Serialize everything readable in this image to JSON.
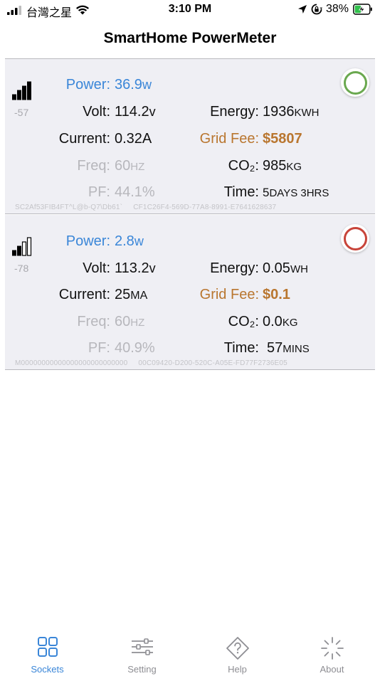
{
  "status_bar": {
    "carrier": "台灣之星",
    "time": "3:10 PM",
    "battery_percent": "38%",
    "icons": [
      "cellular-signal-icon",
      "wifi-icon",
      "location-arrow-icon",
      "rotation-lock-icon",
      "battery-charging-icon"
    ]
  },
  "header": {
    "title": "SmartHome PowerMeter"
  },
  "sockets": [
    {
      "rssi": "-57",
      "signal_bars": 4,
      "state": "on",
      "power_label": "Power:",
      "power_value": "36.9",
      "power_unit": "w",
      "volt_label": "Volt:",
      "volt_value": "114.2",
      "volt_unit": "v",
      "current_label": "Current:",
      "current_value": "0.32A",
      "current_unit": "",
      "freq_label": "Freq:",
      "freq_value": "60",
      "freq_unit": "Hz",
      "pf_label": "PF:",
      "pf_value": "44.1%",
      "energy_label": "Energy:",
      "energy_value": "1936",
      "energy_unit": "KWH",
      "fee_label": "Grid Fee:",
      "fee_value": "$5807",
      "co2_label": "CO₂:",
      "co2_value": "985",
      "co2_unit": "KG",
      "time_label": "Time:",
      "time_value": "5",
      "time_unit": "Days 3Hrs",
      "id_left": "SC2Af53FIB4FT^L@b-Q7\\Db61`",
      "id_right": "CF1C26F4-569D-77A8-8991-E7641628637"
    },
    {
      "rssi": "-78",
      "signal_bars": 2,
      "state": "off",
      "power_label": "Power:",
      "power_value": "2.8",
      "power_unit": "w",
      "volt_label": "Volt:",
      "volt_value": "113.2",
      "volt_unit": "v",
      "current_label": "Current:",
      "current_value": "25",
      "current_unit": "mA",
      "freq_label": "Freq:",
      "freq_value": "60",
      "freq_unit": "Hz",
      "pf_label": "PF:",
      "pf_value": "40.9%",
      "energy_label": "Energy:",
      "energy_value": "0.05",
      "energy_unit": "WH",
      "fee_label": "Grid Fee:",
      "fee_value": "$0.1",
      "co2_label": "CO₂:",
      "co2_value": "0.0",
      "co2_unit": "KG",
      "time_label": "Time:",
      "time_value": "57",
      "time_unit": "mins",
      "id_left": "M00000000000000000000000000",
      "id_right": "00C09420-D200-520C-A05E-FD77F2736E05"
    }
  ],
  "tabs": [
    {
      "label": "Sockets",
      "icon": "grid-icon",
      "active": true
    },
    {
      "label": "Setting",
      "icon": "sliders-icon",
      "active": false
    },
    {
      "label": "Help",
      "icon": "help-diamond-icon",
      "active": false
    },
    {
      "label": "About",
      "icon": "spinner-icon",
      "active": false
    }
  ],
  "colors": {
    "accent_blue": "#3a86d8",
    "fee_orange": "#b9762f",
    "muted_gray": "#b7b7bc",
    "on_green": "#6aa84f",
    "off_red": "#c8443a",
    "card_bg": "#efeff4"
  }
}
